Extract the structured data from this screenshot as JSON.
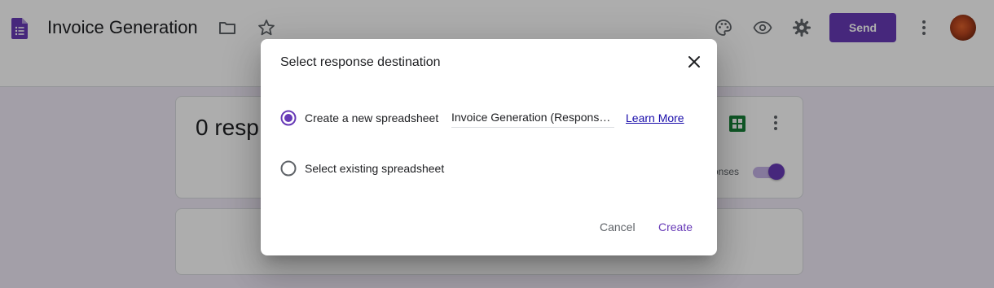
{
  "header": {
    "title": "Invoice Generation",
    "send_label": "Send",
    "icons": [
      "forms-logo-icon",
      "folder-icon",
      "star-icon",
      "palette-icon",
      "preview-eye-icon",
      "settings-gear-icon",
      "more-vert-icon"
    ]
  },
  "responses_card": {
    "count_text": "0 resp",
    "accepting_text": "Accepting responses",
    "accepting_enabled": true
  },
  "dialog": {
    "title": "Select response destination",
    "options": [
      {
        "label": "Create a new spreadsheet",
        "selected": true
      },
      {
        "label": "Select existing spreadsheet",
        "selected": false
      }
    ],
    "spreadsheet_name": "Invoice Generation (Responses)",
    "learn_more": "Learn More",
    "cancel_label": "Cancel",
    "create_label": "Create"
  },
  "colors": {
    "accent": "#673ab7",
    "background": "#f0ebf8",
    "sheets_green": "#188038",
    "link": "#1a0dab"
  }
}
